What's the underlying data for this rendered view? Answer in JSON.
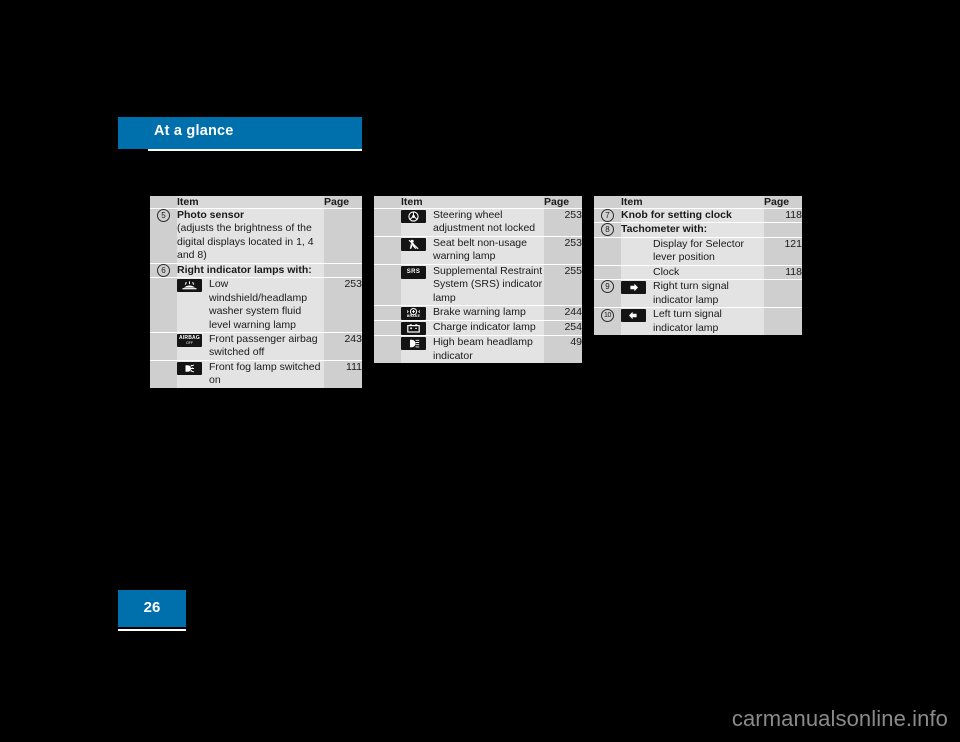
{
  "chapter": {
    "title": "At a glance"
  },
  "page": {
    "number": "26"
  },
  "watermark": {
    "text": "carmanualsonline.info"
  },
  "colors": {
    "accent_blue": "#0070ad",
    "table_body_gray": "#e3e3e3",
    "table_alt_gray": "#cfcfcf",
    "symbol_black": "#141414",
    "page_background": "#000000"
  },
  "tables": [
    {
      "id": "table-1",
      "headers": {
        "num": "",
        "item": "Item",
        "page": "Page"
      },
      "rows": [
        {
          "num": "5",
          "icon": "",
          "item_bold": "Photo sensor",
          "item": "(adjusts the brightness of the digital displays located in 1, 4 and 8)",
          "page": ""
        },
        {
          "num": "6",
          "icon": "",
          "item_bold": "Right indicator lamps with:",
          "item": "",
          "page": ""
        },
        {
          "num": "",
          "icon": "windshield-washer-fluid-icon",
          "item_bold": "",
          "item": "Low windshield/headlamp washer system fluid level warning lamp",
          "page": "253"
        },
        {
          "num": "",
          "icon": "airbag-off-icon",
          "item_bold": "",
          "item": "Front passenger airbag switched off",
          "page": "243"
        },
        {
          "num": "",
          "icon": "front-fog-lamp-icon",
          "item_bold": "",
          "item": "Front fog lamp switched on",
          "page": "111"
        }
      ]
    },
    {
      "id": "table-2",
      "headers": {
        "num": "",
        "item": "Item",
        "page": "Page"
      },
      "rows": [
        {
          "num": "",
          "icon": "steering-wheel-icon",
          "item_bold": "",
          "item": "Steering wheel adjustment not locked",
          "page": "253"
        },
        {
          "num": "",
          "icon": "seat-belt-icon",
          "item_bold": "",
          "item": "Seat belt non-usage warning lamp",
          "page": "253"
        },
        {
          "num": "",
          "icon": "srs-icon",
          "item_bold": "",
          "item": "Supplemental Restraint System (SRS) indicator lamp",
          "page": "255"
        },
        {
          "num": "",
          "icon": "brake-warning-icon",
          "item_bold": "",
          "item": "Brake warning lamp",
          "page": "244"
        },
        {
          "num": "",
          "icon": "battery-charge-icon",
          "item_bold": "",
          "item": "Charge indicator lamp",
          "page": "254"
        },
        {
          "num": "",
          "icon": "high-beam-icon",
          "item_bold": "",
          "item": "High beam headlamp indicator",
          "page": "49"
        }
      ]
    },
    {
      "id": "table-3",
      "headers": {
        "num": "",
        "item": "Item",
        "page": "Page"
      },
      "rows": [
        {
          "num": "7",
          "icon": "",
          "item_bold": "Knob for setting clock",
          "item": "",
          "page": "118"
        },
        {
          "num": "8",
          "icon": "",
          "item_bold": "Tachometer with:",
          "item": "",
          "page": ""
        },
        {
          "num": "",
          "icon": "",
          "item_bold": "",
          "item": "Display for Selector lever position",
          "page": "121"
        },
        {
          "num": "",
          "icon": "",
          "item_bold": "",
          "item": "Clock",
          "page": "118"
        },
        {
          "num": "9",
          "icon": "right-turn-signal-icon",
          "item_bold": "",
          "item": "Right turn signal indicator lamp",
          "page": ""
        },
        {
          "num": "10",
          "icon": "left-turn-signal-icon",
          "item_bold": "",
          "item": "Left turn signal indicator lamp",
          "page": ""
        }
      ]
    }
  ]
}
